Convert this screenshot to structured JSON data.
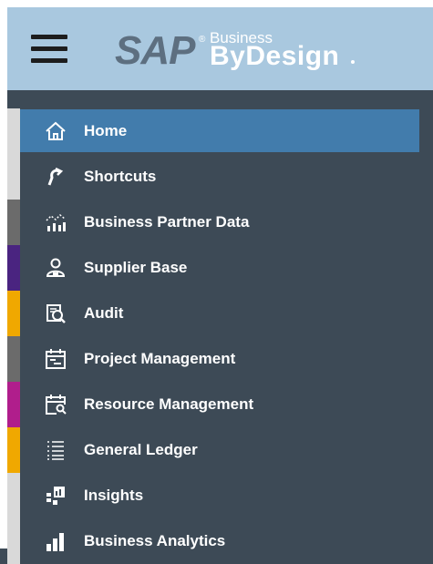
{
  "header": {
    "menu_icon": "hamburger-icon",
    "logo": {
      "brand": "SAP",
      "registered": "®",
      "line1": "Business",
      "line2": "ByDesign"
    }
  },
  "colors": {
    "header_bg": "#a9c8df",
    "nav_bg": "#3d4a56",
    "active_bg": "#427cac"
  },
  "nav": {
    "items": [
      {
        "label": "Home",
        "icon": "home-icon",
        "stripe": "#d9d9d9",
        "active": true
      },
      {
        "label": "Shortcuts",
        "icon": "shortcut-arrow-icon",
        "stripe": "#d9d9d9",
        "active": false
      },
      {
        "label": "Business Partner Data",
        "icon": "partner-data-icon",
        "stripe": "#6b6b6b",
        "active": false
      },
      {
        "label": "Supplier Base",
        "icon": "supplier-icon",
        "stripe": "#4a2480",
        "active": false
      },
      {
        "label": "Audit",
        "icon": "audit-icon",
        "stripe": "#f0a800",
        "active": false
      },
      {
        "label": "Project Management",
        "icon": "project-icon",
        "stripe": "#6b6b6b",
        "active": false
      },
      {
        "label": "Resource Management",
        "icon": "resource-icon",
        "stripe": "#b01e8c",
        "active": false
      },
      {
        "label": "General Ledger",
        "icon": "ledger-list-icon",
        "stripe": "#f0a800",
        "active": false
      },
      {
        "label": "Insights",
        "icon": "insights-icon",
        "stripe": "#d9d9d9",
        "active": false
      },
      {
        "label": "Business Analytics",
        "icon": "analytics-icon",
        "stripe": "#d9d9d9",
        "active": false
      }
    ]
  }
}
